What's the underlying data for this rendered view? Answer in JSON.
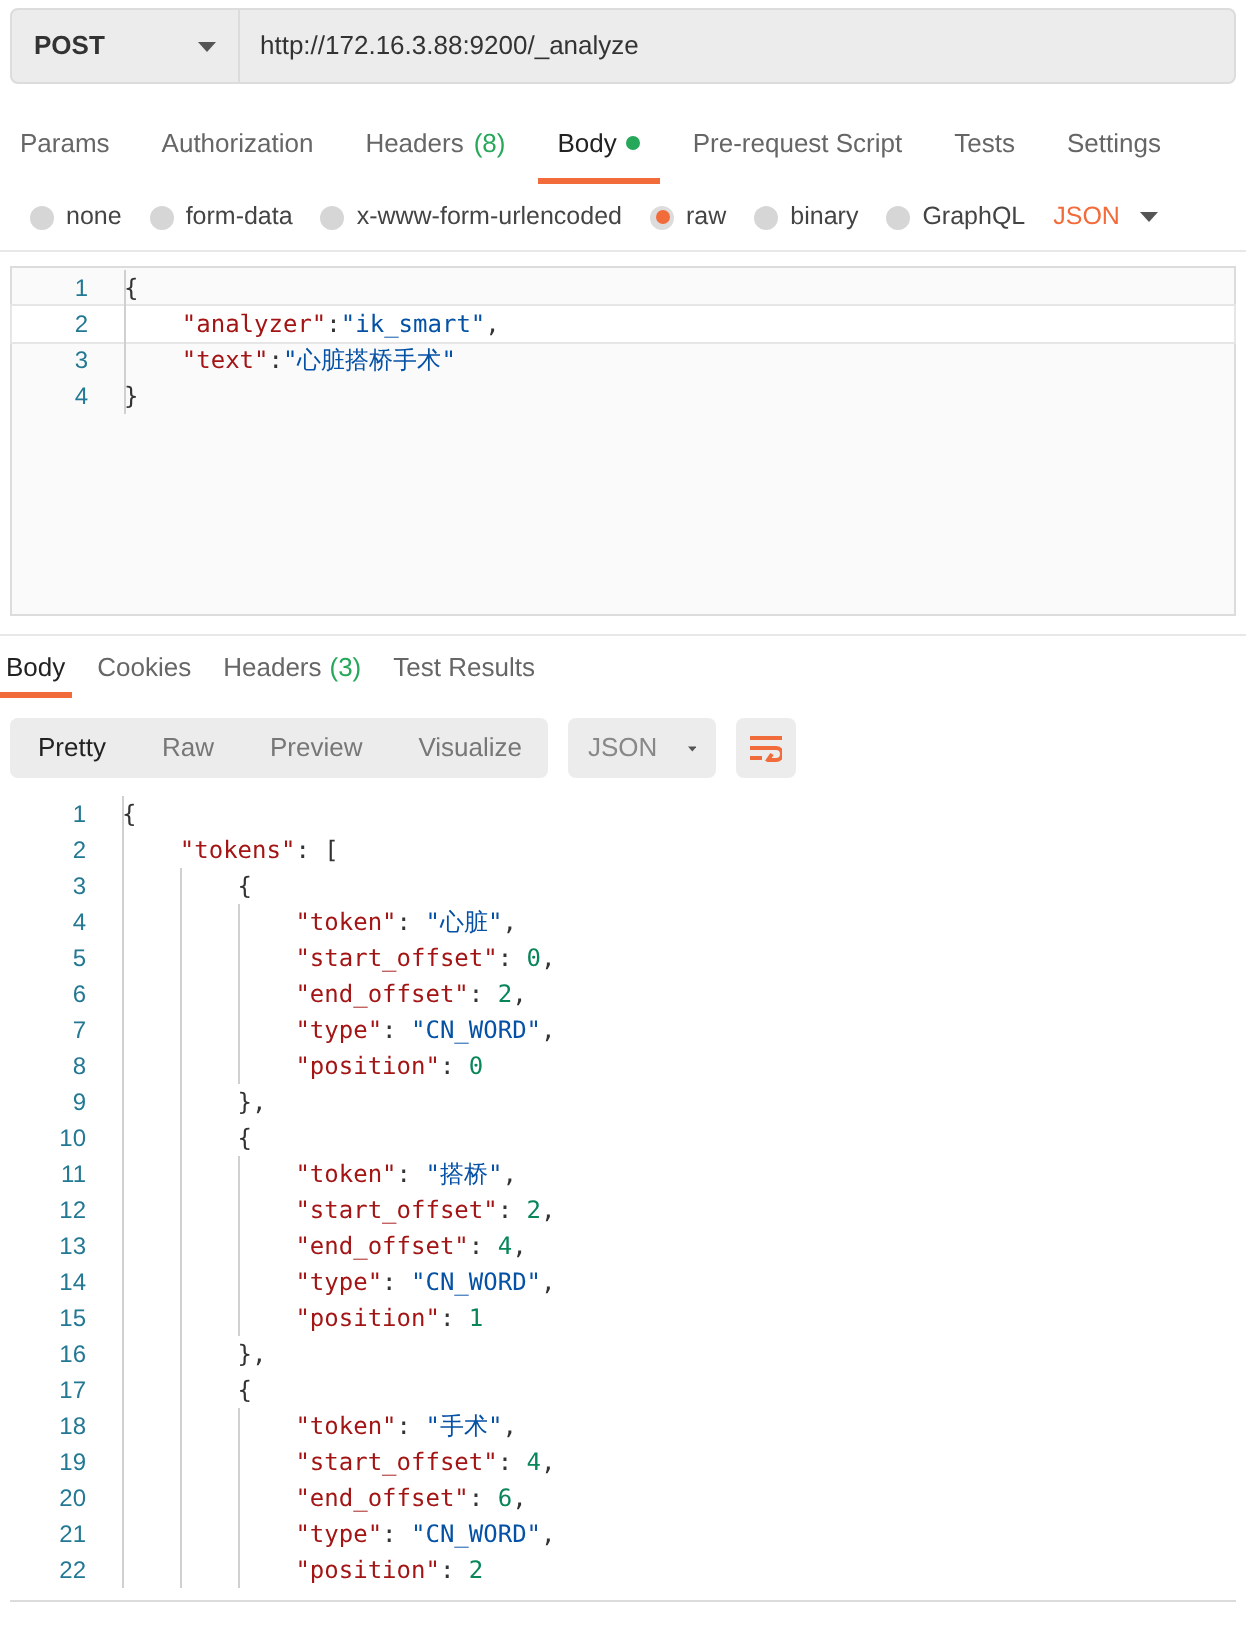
{
  "request": {
    "method": "POST",
    "url": "http://172.16.3.88:9200/_analyze"
  },
  "request_tabs": [
    {
      "label": "Params",
      "selected": false
    },
    {
      "label": "Authorization",
      "selected": false
    },
    {
      "label": "Headers",
      "count": "(8)",
      "selected": false
    },
    {
      "label": "Body",
      "selected": true,
      "dot": true
    },
    {
      "label": "Pre-request Script",
      "selected": false
    },
    {
      "label": "Tests",
      "selected": false
    },
    {
      "label": "Settings",
      "selected": false
    }
  ],
  "body_types": [
    {
      "label": "none",
      "selected": false
    },
    {
      "label": "form-data",
      "selected": false
    },
    {
      "label": "x-www-form-urlencoded",
      "selected": false
    },
    {
      "label": "raw",
      "selected": true
    },
    {
      "label": "binary",
      "selected": false
    },
    {
      "label": "GraphQL",
      "selected": false
    }
  ],
  "body_format": "JSON",
  "request_body": [
    {
      "number": "1",
      "active": false,
      "tokens": [
        {
          "kind": "punct",
          "text": "{"
        }
      ]
    },
    {
      "number": "2",
      "active": true,
      "tokens": [
        {
          "kind": "key",
          "text": "    \"analyzer\""
        },
        {
          "kind": "punct",
          "text": ":"
        },
        {
          "kind": "string",
          "text": "\"ik_smart\""
        },
        {
          "kind": "punct",
          "text": ","
        }
      ]
    },
    {
      "number": "3",
      "active": false,
      "tokens": [
        {
          "kind": "key",
          "text": "    \"text\""
        },
        {
          "kind": "punct",
          "text": ":"
        },
        {
          "kind": "string",
          "text": "\"心脏搭桥手术\""
        }
      ]
    },
    {
      "number": "4",
      "active": false,
      "tokens": [
        {
          "kind": "punct",
          "text": "}"
        }
      ]
    }
  ],
  "response_tabs": [
    {
      "label": "Body",
      "selected": true
    },
    {
      "label": "Cookies",
      "selected": false
    },
    {
      "label": "Headers",
      "count": "(3)",
      "selected": false
    },
    {
      "label": "Test Results",
      "selected": false
    }
  ],
  "view_modes": [
    {
      "label": "Pretty",
      "selected": true
    },
    {
      "label": "Raw",
      "selected": false
    },
    {
      "label": "Preview",
      "selected": false
    },
    {
      "label": "Visualize",
      "selected": false
    }
  ],
  "response_format": "JSON",
  "response_body": [
    {
      "number": "1",
      "tokens": [
        {
          "kind": "punct",
          "text": "{"
        }
      ]
    },
    {
      "number": "2",
      "tokens": [
        {
          "kind": "key",
          "text": "    \"tokens\""
        },
        {
          "kind": "punct",
          "text": ": ["
        }
      ]
    },
    {
      "number": "3",
      "tokens": [
        {
          "kind": "punct",
          "text": "        {"
        }
      ]
    },
    {
      "number": "4",
      "tokens": [
        {
          "kind": "key",
          "text": "            \"token\""
        },
        {
          "kind": "punct",
          "text": ": "
        },
        {
          "kind": "string",
          "text": "\"心脏\""
        },
        {
          "kind": "punct",
          "text": ","
        }
      ]
    },
    {
      "number": "5",
      "tokens": [
        {
          "kind": "key",
          "text": "            \"start_offset\""
        },
        {
          "kind": "punct",
          "text": ": "
        },
        {
          "kind": "number",
          "text": "0"
        },
        {
          "kind": "punct",
          "text": ","
        }
      ]
    },
    {
      "number": "6",
      "tokens": [
        {
          "kind": "key",
          "text": "            \"end_offset\""
        },
        {
          "kind": "punct",
          "text": ": "
        },
        {
          "kind": "number",
          "text": "2"
        },
        {
          "kind": "punct",
          "text": ","
        }
      ]
    },
    {
      "number": "7",
      "tokens": [
        {
          "kind": "key",
          "text": "            \"type\""
        },
        {
          "kind": "punct",
          "text": ": "
        },
        {
          "kind": "string",
          "text": "\"CN_WORD\""
        },
        {
          "kind": "punct",
          "text": ","
        }
      ]
    },
    {
      "number": "8",
      "tokens": [
        {
          "kind": "key",
          "text": "            \"position\""
        },
        {
          "kind": "punct",
          "text": ": "
        },
        {
          "kind": "number",
          "text": "0"
        }
      ]
    },
    {
      "number": "9",
      "tokens": [
        {
          "kind": "punct",
          "text": "        },"
        }
      ]
    },
    {
      "number": "10",
      "tokens": [
        {
          "kind": "punct",
          "text": "        {"
        }
      ]
    },
    {
      "number": "11",
      "tokens": [
        {
          "kind": "key",
          "text": "            \"token\""
        },
        {
          "kind": "punct",
          "text": ": "
        },
        {
          "kind": "string",
          "text": "\"搭桥\""
        },
        {
          "kind": "punct",
          "text": ","
        }
      ]
    },
    {
      "number": "12",
      "tokens": [
        {
          "kind": "key",
          "text": "            \"start_offset\""
        },
        {
          "kind": "punct",
          "text": ": "
        },
        {
          "kind": "number",
          "text": "2"
        },
        {
          "kind": "punct",
          "text": ","
        }
      ]
    },
    {
      "number": "13",
      "tokens": [
        {
          "kind": "key",
          "text": "            \"end_offset\""
        },
        {
          "kind": "punct",
          "text": ": "
        },
        {
          "kind": "number",
          "text": "4"
        },
        {
          "kind": "punct",
          "text": ","
        }
      ]
    },
    {
      "number": "14",
      "tokens": [
        {
          "kind": "key",
          "text": "            \"type\""
        },
        {
          "kind": "punct",
          "text": ": "
        },
        {
          "kind": "string",
          "text": "\"CN_WORD\""
        },
        {
          "kind": "punct",
          "text": ","
        }
      ]
    },
    {
      "number": "15",
      "tokens": [
        {
          "kind": "key",
          "text": "            \"position\""
        },
        {
          "kind": "punct",
          "text": ": "
        },
        {
          "kind": "number",
          "text": "1"
        }
      ]
    },
    {
      "number": "16",
      "tokens": [
        {
          "kind": "punct",
          "text": "        },"
        }
      ]
    },
    {
      "number": "17",
      "tokens": [
        {
          "kind": "punct",
          "text": "        {"
        }
      ]
    },
    {
      "number": "18",
      "tokens": [
        {
          "kind": "key",
          "text": "            \"token\""
        },
        {
          "kind": "punct",
          "text": ": "
        },
        {
          "kind": "string",
          "text": "\"手术\""
        },
        {
          "kind": "punct",
          "text": ","
        }
      ]
    },
    {
      "number": "19",
      "tokens": [
        {
          "kind": "key",
          "text": "            \"start_offset\""
        },
        {
          "kind": "punct",
          "text": ": "
        },
        {
          "kind": "number",
          "text": "4"
        },
        {
          "kind": "punct",
          "text": ","
        }
      ]
    },
    {
      "number": "20",
      "tokens": [
        {
          "kind": "key",
          "text": "            \"end_offset\""
        },
        {
          "kind": "punct",
          "text": ": "
        },
        {
          "kind": "number",
          "text": "6"
        },
        {
          "kind": "punct",
          "text": ","
        }
      ]
    },
    {
      "number": "21",
      "tokens": [
        {
          "kind": "key",
          "text": "            \"type\""
        },
        {
          "kind": "punct",
          "text": ": "
        },
        {
          "kind": "string",
          "text": "\"CN_WORD\""
        },
        {
          "kind": "punct",
          "text": ","
        }
      ]
    },
    {
      "number": "22",
      "tokens": [
        {
          "kind": "key",
          "text": "            \"position\""
        },
        {
          "kind": "punct",
          "text": ": "
        },
        {
          "kind": "number",
          "text": "2"
        }
      ]
    }
  ]
}
